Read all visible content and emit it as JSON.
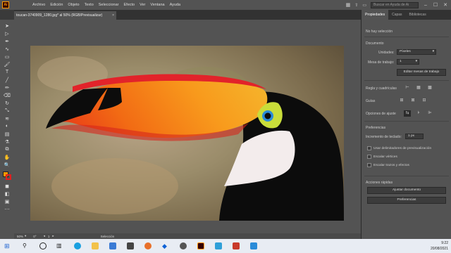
{
  "app": {
    "logo": "Ai"
  },
  "menu": [
    "Archivo",
    "Edición",
    "Objeto",
    "Texto",
    "Seleccionar",
    "Efecto",
    "Ver",
    "Ventana",
    "Ayuda"
  ],
  "search": {
    "placeholder": "Buscar en Ayuda de Ai"
  },
  "document_tab": {
    "title": "toucan-3740909_1280.jpg* al 50% (RGB/Previsualizar)"
  },
  "status": {
    "zoom": "50%",
    "angle": "0°",
    "page": "1",
    "tool": "Selección"
  },
  "panel": {
    "tabs": [
      "Propiedades",
      "Capas",
      "Bibliotecas"
    ],
    "no_selection": "No hay selección",
    "documento": "Documento",
    "unidades_label": "Unidades:",
    "unidades_value": "Píxeles",
    "mesa_label": "Mesa de trabajo:",
    "mesa_value": "1",
    "edit_artboards": "Editar mesas de trabajo",
    "regla": "Regla y cuadrículas",
    "guias": "Guías",
    "opciones_ajuste": "Opciones de ajuste",
    "preferencias": "Preferencias",
    "incremento_label": "Incremento de teclado:",
    "incremento_value": "1 px",
    "chk1": "Usar delimitadores de previsualización",
    "chk2": "Escalar vértices",
    "chk3": "Escalar trazos y efectos",
    "acciones": "Acciones rápidas",
    "ajustar_doc": "Ajustar documento",
    "prefs_btn": "Preferencias"
  },
  "clock": {
    "time": "9:22",
    "date": "20/08/2021"
  },
  "colors": {
    "accent": "#ff9a00",
    "toucan_orange": "#f08a1a",
    "toucan_red": "#e02020"
  }
}
